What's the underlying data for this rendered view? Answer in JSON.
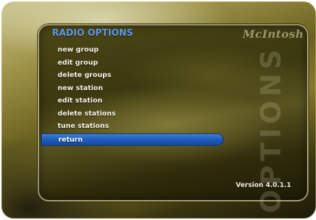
{
  "screen": {
    "title": "RADIO OPTIONS",
    "brand_logo_text": "McIntosh",
    "watermark": "OPTIONS",
    "version": "Version 4.0.1.1"
  },
  "menu": {
    "items": [
      {
        "label": "new group",
        "selected": false
      },
      {
        "label": "edit group",
        "selected": false
      },
      {
        "label": "delete groups",
        "selected": false
      },
      {
        "label": "new station",
        "selected": false
      },
      {
        "label": "edit station",
        "selected": false
      },
      {
        "label": "delete stations",
        "selected": false
      },
      {
        "label": "tune stations",
        "selected": false
      },
      {
        "label": "return",
        "selected": true
      }
    ]
  },
  "colors": {
    "title": "#5d98e8",
    "selection": "#1e5cb8",
    "text": "#f4f2e6",
    "frame_gold": "#9e9348"
  }
}
